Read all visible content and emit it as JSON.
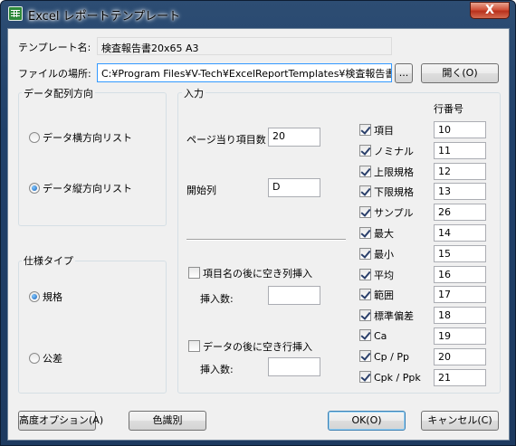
{
  "window": {
    "title": "Excel レポートテンプレート",
    "close_label": "X"
  },
  "template": {
    "name_label": "テンプレート名:",
    "name_value": "検査報告書20x65 A3",
    "location_label": "ファイルの場所:",
    "location_value": "C:¥Program Files¥V-Tech¥ExcelReportTemplates¥検査報告書書式:",
    "browse_label": "...",
    "open_label": "開く(O)"
  },
  "direction_group": {
    "title": "データ配列方向",
    "options": [
      {
        "label": "データ横方向リスト",
        "selected": false
      },
      {
        "label": "データ縦方向リスト",
        "selected": true
      }
    ]
  },
  "spec_group": {
    "title": "仕様タイプ",
    "options": [
      {
        "label": "規格",
        "selected": true
      },
      {
        "label": "公差",
        "selected": false
      }
    ]
  },
  "input_group": {
    "title": "入力",
    "items_per_page_label": "ページ当り項目数",
    "items_per_page_value": "20",
    "start_column_label": "開始列",
    "start_column_value": "D",
    "insert_col_label": "項目名の後に空き列挿入",
    "insert_col_checked": false,
    "insert_col_count_label": "挿入数:",
    "insert_col_count_value": "",
    "insert_row_label": "データの後に空き行挿入",
    "insert_row_checked": false,
    "insert_row_count_label": "挿入数:",
    "insert_row_count_value": "",
    "row_header": "行番号",
    "rows": [
      {
        "label": "項目",
        "checked": true,
        "value": "10"
      },
      {
        "label": "ノミナル",
        "checked": true,
        "value": "11"
      },
      {
        "label": "上限規格",
        "checked": true,
        "value": "12"
      },
      {
        "label": "下限規格",
        "checked": true,
        "value": "13"
      },
      {
        "label": "サンプル",
        "checked": true,
        "value": "26"
      },
      {
        "label": "最大",
        "checked": true,
        "value": "14"
      },
      {
        "label": "最小",
        "checked": true,
        "value": "15"
      },
      {
        "label": "平均",
        "checked": true,
        "value": "16"
      },
      {
        "label": "範囲",
        "checked": true,
        "value": "17"
      },
      {
        "label": "標準偏差",
        "checked": true,
        "value": "18"
      },
      {
        "label": "Ca",
        "checked": true,
        "value": "19"
      },
      {
        "label": "Cp / Pp",
        "checked": true,
        "value": "20"
      },
      {
        "label": "Cpk / Ppk",
        "checked": true,
        "value": "21"
      }
    ]
  },
  "footer": {
    "advanced_label": "高度オプション(A)",
    "color_label": "色識別",
    "ok_label": "OK(O)",
    "cancel_label": "キャンセル(C)"
  }
}
